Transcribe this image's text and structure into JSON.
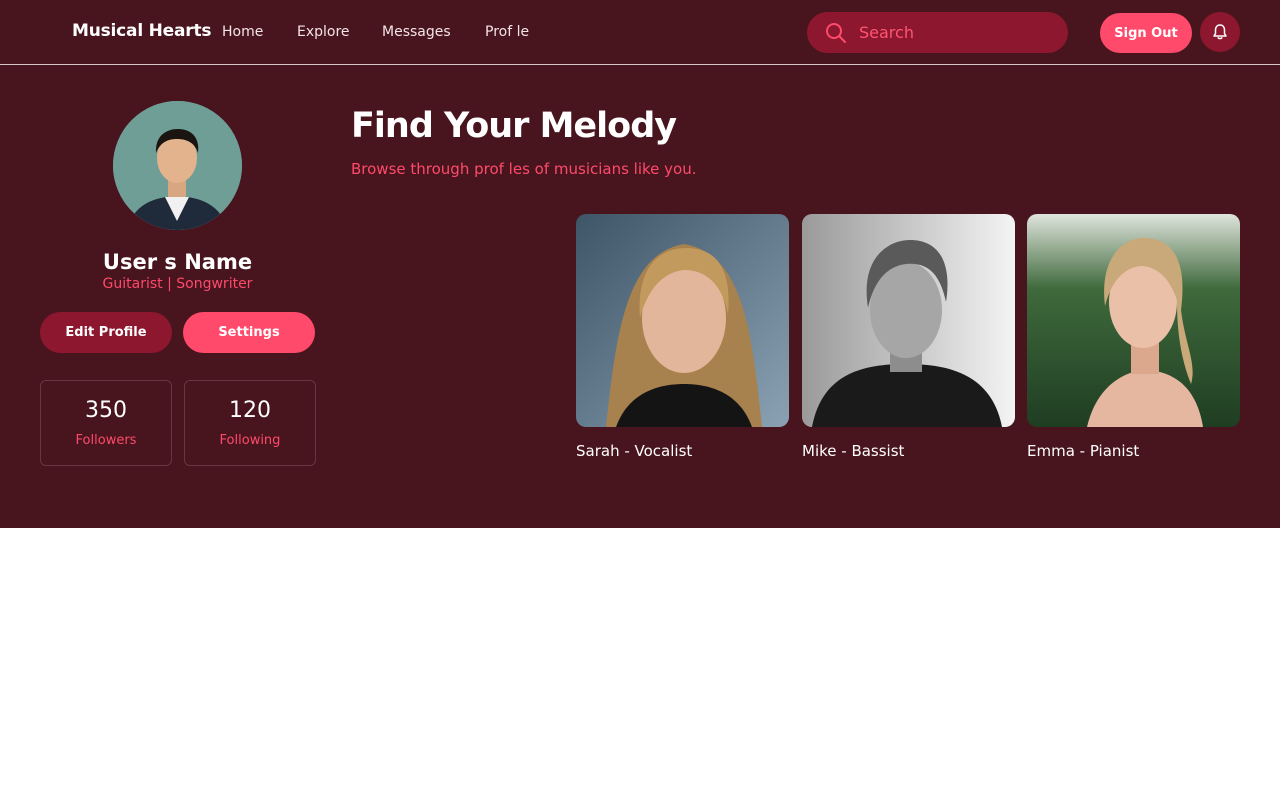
{
  "brand": {
    "name": "Musical Hearts"
  },
  "nav": {
    "items": [
      {
        "label": "Home"
      },
      {
        "label": "Explore"
      },
      {
        "label": "Messages"
      },
      {
        "label": "Prof le"
      }
    ]
  },
  "search": {
    "placeholder": "Search",
    "value": ""
  },
  "header": {
    "sign_out_label": "Sign Out"
  },
  "profile": {
    "name": "User s Name",
    "role": "Guitarist | Songwriter",
    "edit_label": "Edit Profile",
    "settings_label": "Settings",
    "stats": [
      {
        "value": "350",
        "label": "Followers"
      },
      {
        "value": "120",
        "label": "Following"
      }
    ]
  },
  "main": {
    "title": "Find Your Melody",
    "subtitle": "Browse through prof les of musicians like you.",
    "musicians": [
      {
        "caption": "Sarah - Vocalist"
      },
      {
        "caption": "Mike - Bassist"
      },
      {
        "caption": "Emma - Pianist"
      }
    ]
  },
  "colors": {
    "background": "#48141e",
    "accent": "#ff4a6b",
    "accent_dark": "#8e1730"
  },
  "icons": {
    "search": "search-icon",
    "notifications": "bell-icon"
  }
}
